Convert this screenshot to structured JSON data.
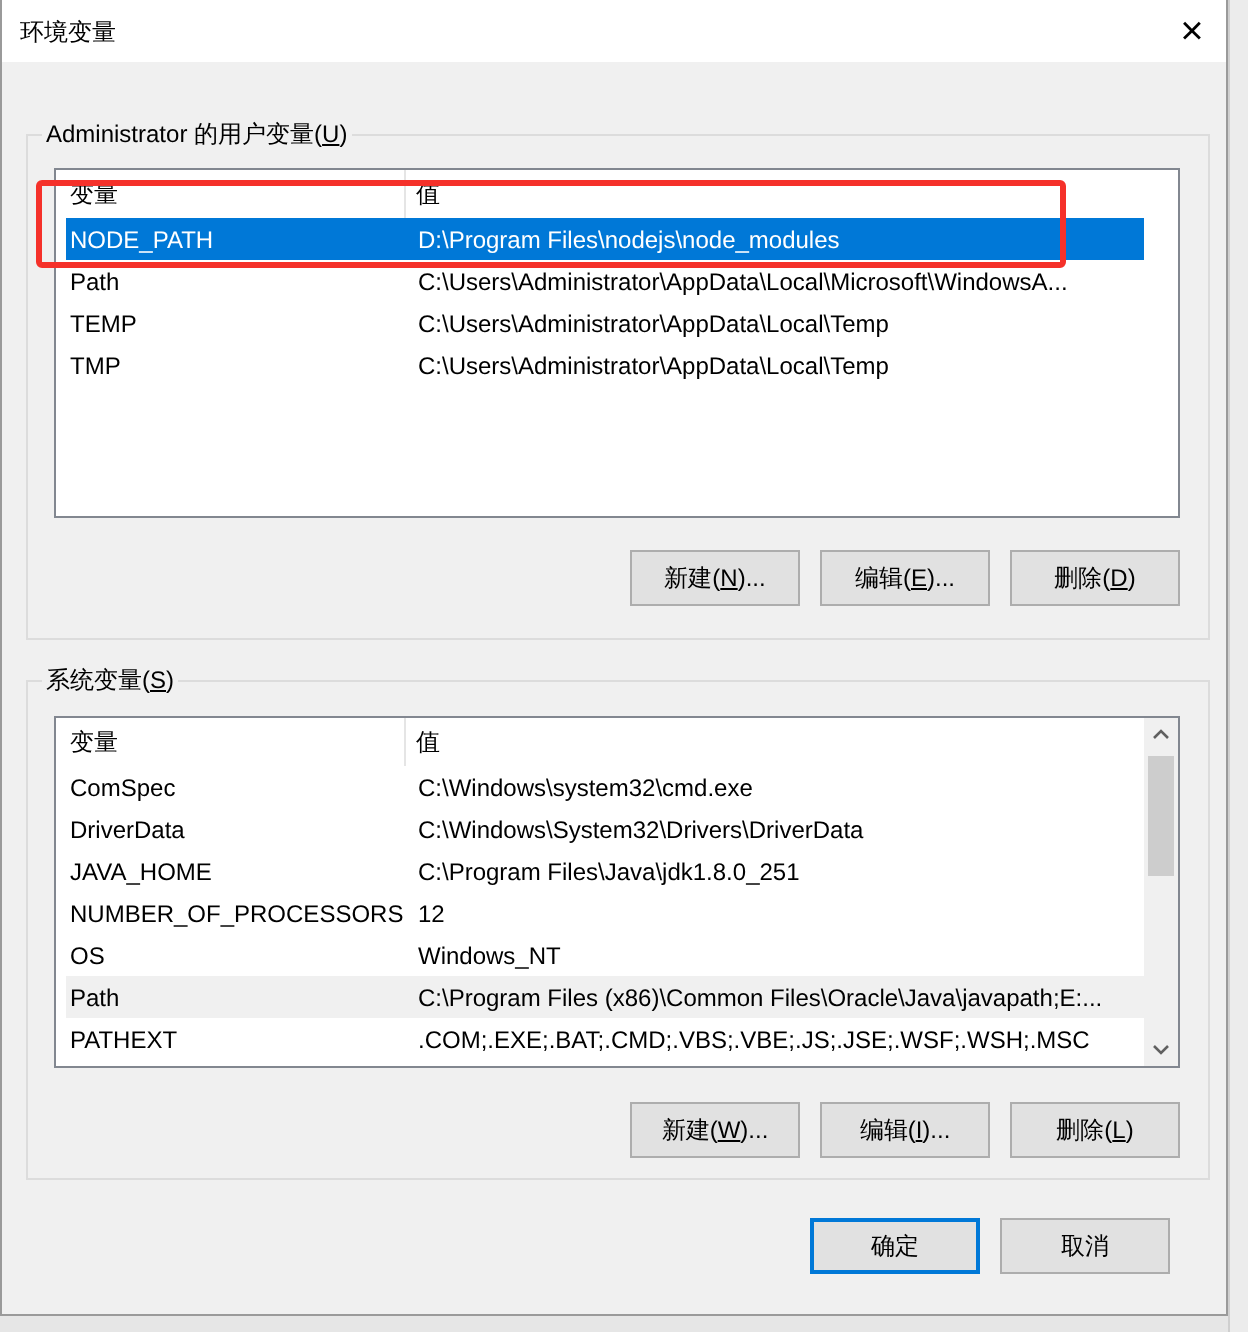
{
  "window": {
    "title": "环境变量",
    "close": "×"
  },
  "user_variables": {
    "legend": [
      "Administrator 的用户变量(",
      "U",
      ")"
    ],
    "highlighted": true,
    "columns": [
      "变量",
      "值"
    ],
    "rows": [
      {
        "name": "NODE_PATH",
        "value": "D:\\Program Files\\nodejs\\node_modules",
        "selected": true
      },
      {
        "name": "Path",
        "value": "C:\\Users\\Administrator\\AppData\\Local\\Microsoft\\WindowsA...",
        "selected": false
      },
      {
        "name": "TEMP",
        "value": "C:\\Users\\Administrator\\AppData\\Local\\Temp",
        "selected": false
      },
      {
        "name": "TMP",
        "value": "C:\\Users\\Administrator\\AppData\\Local\\Temp",
        "selected": false
      }
    ],
    "buttons": [
      [
        "新建(",
        "N",
        ")..."
      ],
      [
        "编辑(",
        "E",
        ")..."
      ],
      [
        "删除(",
        "D",
        ")"
      ]
    ]
  },
  "system_variables": {
    "legend": [
      "系统变量(",
      "S",
      ")"
    ],
    "columns": [
      "变量",
      "值"
    ],
    "rows": [
      {
        "name": "ComSpec",
        "value": "C:\\Windows\\system32\\cmd.exe",
        "selected": false,
        "hovered": false
      },
      {
        "name": "DriverData",
        "value": "C:\\Windows\\System32\\Drivers\\DriverData",
        "selected": false,
        "hovered": false
      },
      {
        "name": "JAVA_HOME",
        "value": "C:\\Program Files\\Java\\jdk1.8.0_251",
        "selected": false,
        "hovered": false
      },
      {
        "name": "NUMBER_OF_PROCESSORS",
        "value": "12",
        "selected": false,
        "hovered": false
      },
      {
        "name": "OS",
        "value": "Windows_NT",
        "selected": false,
        "hovered": false
      },
      {
        "name": "Path",
        "value": "C:\\Program Files (x86)\\Common Files\\Oracle\\Java\\javapath;E:...",
        "selected": false,
        "hovered": true
      },
      {
        "name": "PATHEXT",
        "value": ".COM;.EXE;.BAT;.CMD;.VBS;.VBE;.JS;.JSE;.WSF;.WSH;.MSC",
        "selected": false,
        "hovered": false
      }
    ],
    "buttons": [
      [
        "新建(",
        "W",
        ")..."
      ],
      [
        "编辑(",
        "I",
        ")..."
      ],
      [
        "删除(",
        "L",
        ")"
      ]
    ]
  },
  "footer_buttons": [
    {
      "label": "确定",
      "default": true
    },
    {
      "label": "取消",
      "default": false
    }
  ]
}
